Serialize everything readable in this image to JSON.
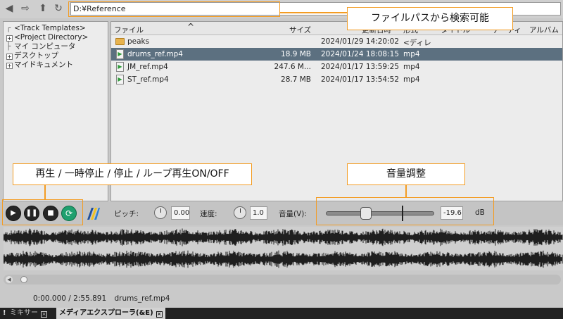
{
  "toolbar": {
    "icons": [
      "back-icon",
      "forward-icon",
      "up-icon",
      "refresh-icon"
    ],
    "path": "D:¥Reference"
  },
  "tree": {
    "items": [
      {
        "label": "<Track Templates>",
        "expander": "line"
      },
      {
        "label": "<Project Directory>",
        "expander": "plus"
      },
      {
        "label": "マイ コンピュータ",
        "expander": "line"
      },
      {
        "label": "デスクトップ",
        "expander": "plus"
      },
      {
        "label": "マイドキュメント",
        "expander": "plus"
      }
    ]
  },
  "filelist": {
    "columns": {
      "name": "ファイル",
      "size": "サイズ",
      "date": "更新日時",
      "type": "形式",
      "title": "タイトル",
      "artist": "アーティ",
      "album": "アルバム"
    },
    "rows": [
      {
        "name": "peaks",
        "size": "",
        "date": "2024/01/29 14:20:02",
        "type": "<ディレ",
        "kind": "folder",
        "selected": false
      },
      {
        "name": "drums_ref.mp4",
        "size": "18.9 MB",
        "date": "2024/01/24 18:08:15",
        "type": "mp4",
        "kind": "file",
        "selected": true
      },
      {
        "name": "JM_ref.mp4",
        "size": "247.6 M...",
        "date": "2024/01/17 13:59:25",
        "type": "mp4",
        "kind": "file",
        "selected": false
      },
      {
        "name": "ST_ref.mp4",
        "size": "28.7 MB",
        "date": "2024/01/17 13:54:52",
        "type": "mp4",
        "kind": "file",
        "selected": false
      }
    ]
  },
  "callouts": {
    "path_search": "ファイルパスから検索可能",
    "playback": "再生 / 一時停止 / 停止 / ループ再生ON/OFF",
    "volume": "音量調整"
  },
  "transport": {
    "buttons": [
      "play-icon",
      "pause-icon",
      "stop-icon",
      "loop-icon"
    ],
    "pitch_label": "ピッチ:",
    "pitch_value": "0.00",
    "rate_label": "速度:",
    "rate_value": "1.0",
    "volume_label": "音量(V):",
    "volume_value": "-19.6",
    "volume_unit": "dB"
  },
  "status": {
    "time": "0:00.000 / 2:55.891",
    "file": "drums_ref.mp4"
  },
  "tabs": [
    {
      "label": "ミキサー",
      "active": false
    },
    {
      "label": "メディアエクスプローラ(&E)",
      "active": true
    }
  ],
  "colors": {
    "accent": "#f39c23",
    "selection": "#5c7080",
    "loop_button": "#1fa06f"
  }
}
